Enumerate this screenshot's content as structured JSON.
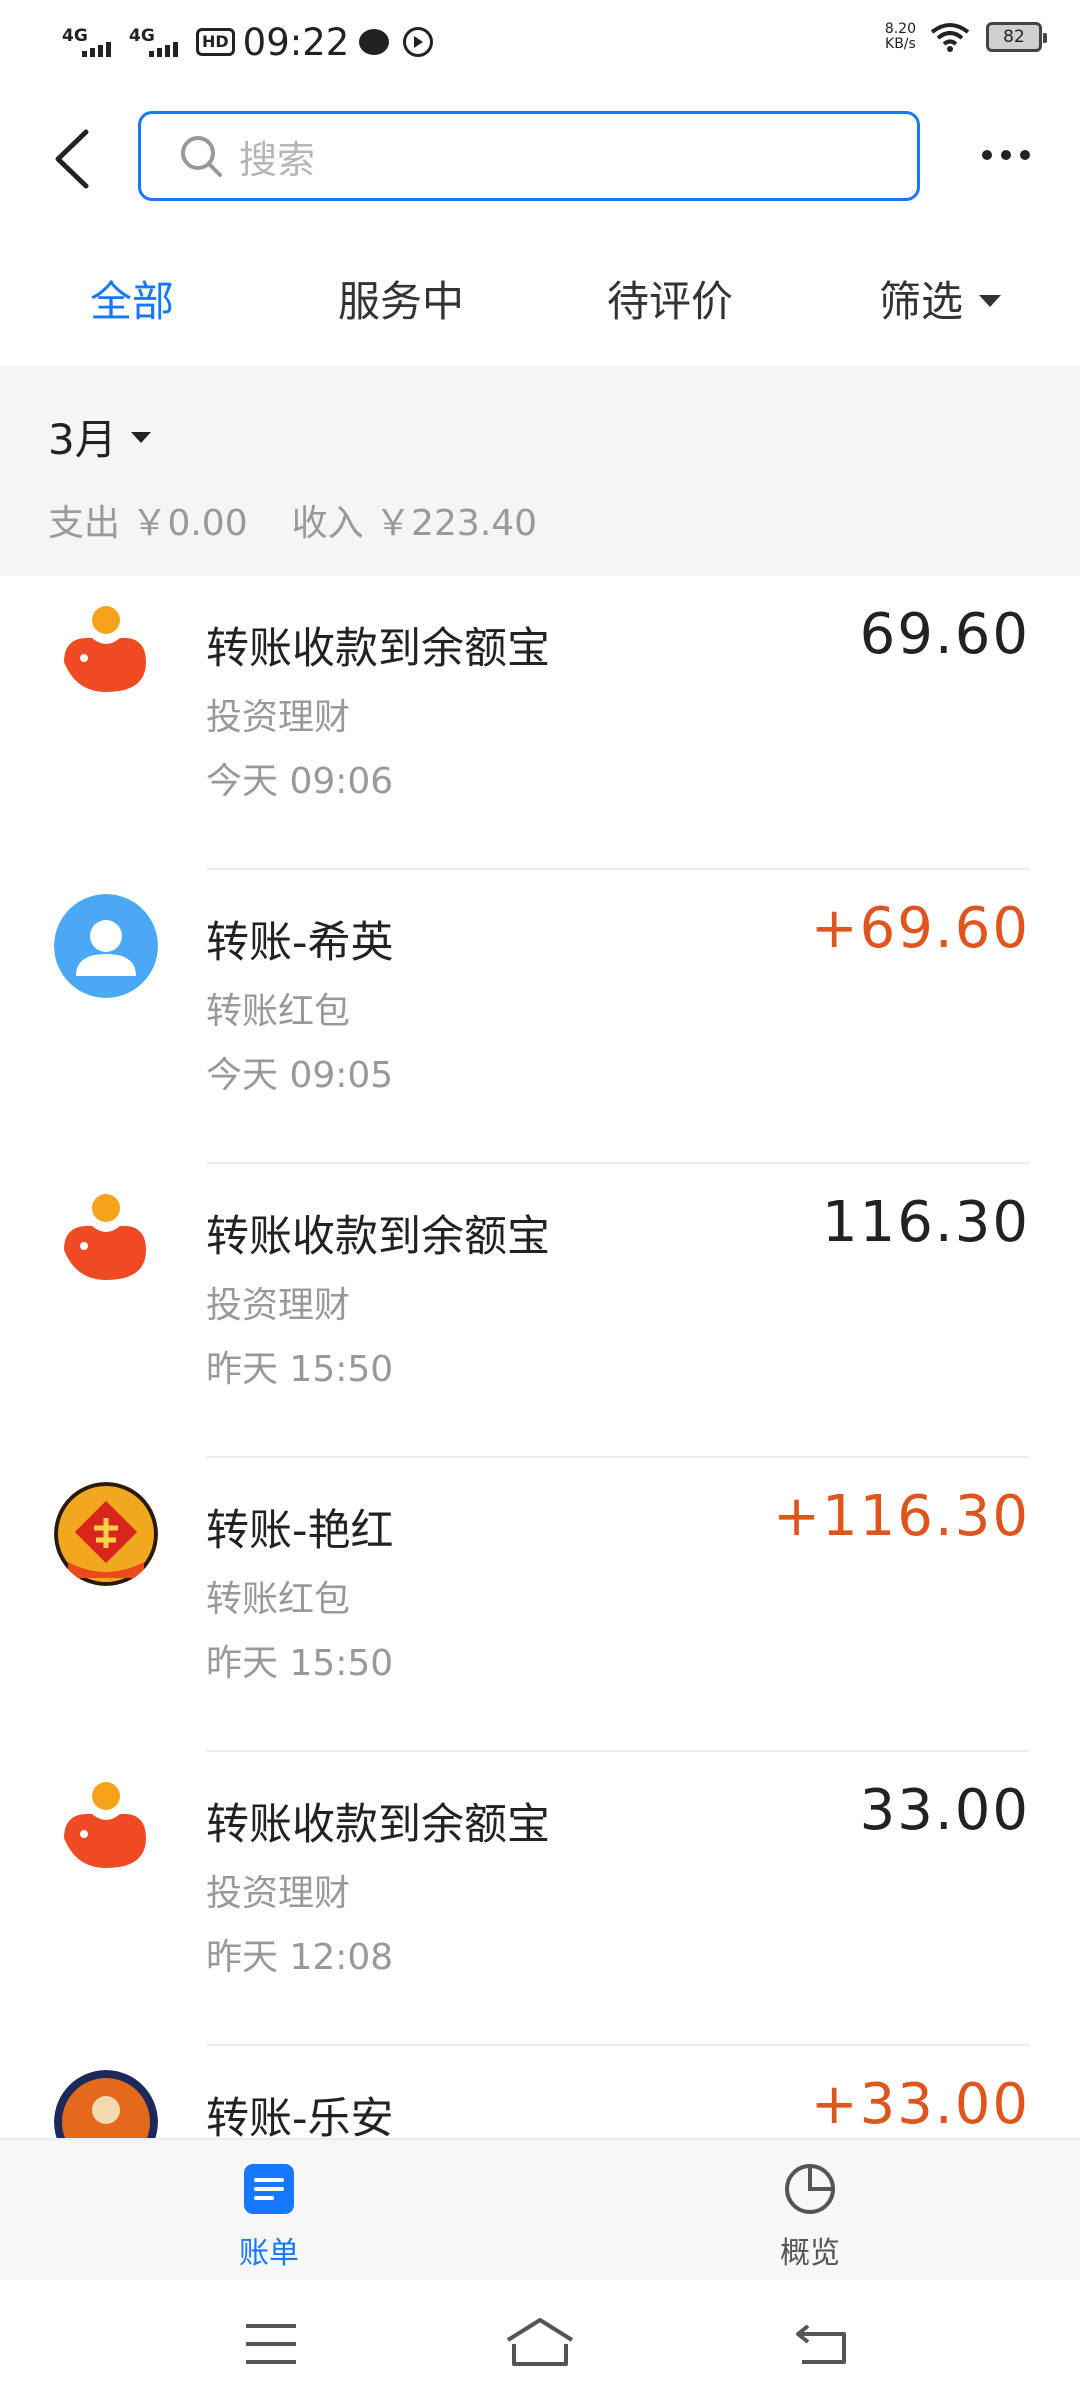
{
  "status_bar": {
    "signal1": "4G",
    "signal2": "4G",
    "hd": "HD",
    "time": "09:22",
    "speed_value": "8.20",
    "speed_unit": "KB/s",
    "battery": "82"
  },
  "search": {
    "placeholder": "搜索"
  },
  "tabs": {
    "all": "全部",
    "in_service": "服务中",
    "to_review": "待评价",
    "filter": "筛选"
  },
  "summary": {
    "month": "3月",
    "expense": "支出 ￥0.00",
    "income": "收入 ￥223.40"
  },
  "transactions": [
    {
      "title": "转账收款到余额宝",
      "category": "投资理财",
      "time": "今天  09:06",
      "amount": "69.60",
      "income": false,
      "avatar": "yuebao-logo"
    },
    {
      "title": "转账-希英",
      "category": "转账红包",
      "time": "今天  09:05",
      "amount": "+69.60",
      "income": true,
      "avatar": "default-user"
    },
    {
      "title": "转账收款到余额宝",
      "category": "投资理财",
      "time": "昨天  15:50",
      "amount": "116.30",
      "income": false,
      "avatar": "yuebao-logo"
    },
    {
      "title": "转账-艳红",
      "category": "转账红包",
      "time": "昨天  15:50",
      "amount": "+116.30",
      "income": true,
      "avatar": "fu-photo"
    },
    {
      "title": "转账收款到余额宝",
      "category": "投资理财",
      "time": "昨天  12:08",
      "amount": "33.00",
      "income": false,
      "avatar": "yuebao-logo"
    },
    {
      "title": "转账-乐安",
      "category": "",
      "time": "",
      "amount": "+33.00",
      "income": true,
      "avatar": "user-photo"
    }
  ],
  "bottom_nav": {
    "bill": "账单",
    "overview": "概览"
  },
  "colors": {
    "accent": "#1677ff",
    "income": "#e0551e",
    "yuebao": "#f04a24"
  }
}
